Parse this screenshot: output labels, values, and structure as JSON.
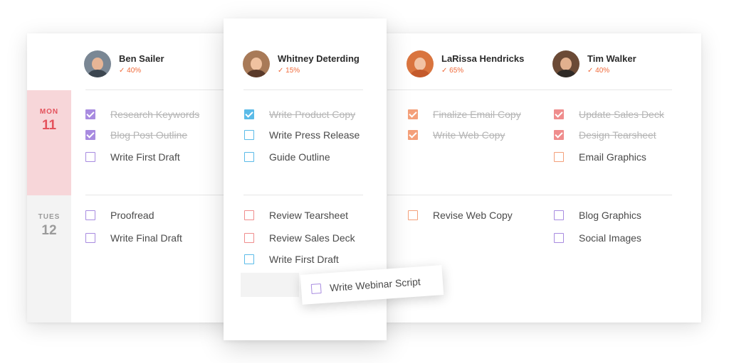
{
  "colors": {
    "purple": "#a88be0",
    "blue": "#5bbbe8",
    "orange": "#f4a07a",
    "red": "#ef8d8d",
    "accent_text": "#f06a3a",
    "mon_bg": "#f7d6d9"
  },
  "days": [
    {
      "name": "MON",
      "number": "11"
    },
    {
      "name": "TUES",
      "number": "12"
    }
  ],
  "people": [
    {
      "name": "Ben Sailer",
      "progress": "✓ 40%"
    },
    {
      "name": "Whitney Deterding",
      "progress": "✓ 15%"
    },
    {
      "name": "LaRissa Hendricks",
      "progress": "✓ 65%"
    },
    {
      "name": "Tim Walker",
      "progress": "✓ 40%"
    }
  ],
  "tasks": {
    "ben": {
      "mon": [
        "Research Keywords",
        "Blog Post Outline",
        "Write First Draft"
      ],
      "tue": [
        "Proofread",
        "Write Final Draft"
      ]
    },
    "whitney": {
      "mon": [
        "Write Product Copy",
        "Write Press Release",
        "Guide Outline"
      ],
      "tue": [
        "Review Tearsheet",
        "Review Sales Deck",
        "Write First Draft"
      ]
    },
    "larissa": {
      "mon": [
        "Finalize Email Copy",
        "Write Web Copy"
      ],
      "tue": [
        "Revise Web Copy"
      ]
    },
    "tim": {
      "mon": [
        "Update Sales Deck",
        "Design Tearsheet",
        "Email Graphics"
      ],
      "tue": [
        "Blog Graphics",
        "Social Images"
      ]
    }
  },
  "dragging_task": "Write Webinar Script"
}
